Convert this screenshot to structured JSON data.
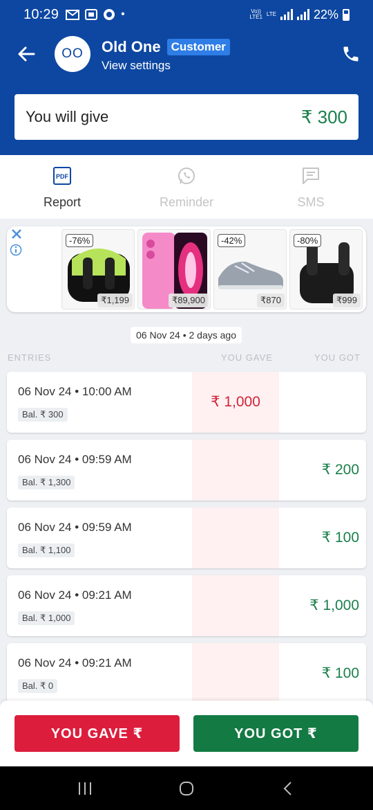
{
  "status_bar": {
    "time": "10:29",
    "network": "LTE",
    "battery": "22%",
    "dot": "•"
  },
  "header": {
    "avatar_initials": "OO",
    "name": "Old One",
    "badge": "Customer",
    "subtitle": "View settings"
  },
  "balance": {
    "label": "You will give",
    "amount": "₹ 300"
  },
  "actions": [
    {
      "label": "Report",
      "icon": "pdf-icon",
      "enabled": true
    },
    {
      "label": "Reminder",
      "icon": "whatsapp-icon",
      "enabled": false
    },
    {
      "label": "SMS",
      "icon": "sms-icon",
      "enabled": false
    }
  ],
  "ad": {
    "products": [
      {
        "discount": "-76%",
        "price": "₹1,199",
        "kind": "earbuds"
      },
      {
        "discount": "",
        "price": "₹89,900",
        "kind": "phone"
      },
      {
        "discount": "-42%",
        "price": "₹870",
        "kind": "shoes"
      },
      {
        "discount": "-80%",
        "price": "₹999",
        "kind": "earbuds-dark"
      }
    ]
  },
  "date_chip": "06 Nov 24 • 2 days ago",
  "columns": {
    "entries": "ENTRIES",
    "you_gave": "YOU GAVE",
    "you_got": "YOU GOT"
  },
  "entries": [
    {
      "datetime": "06 Nov 24 • 10:00 AM",
      "balance": "Bal. ₹ 300",
      "gave": "₹ 1,000",
      "got": ""
    },
    {
      "datetime": "06 Nov 24 • 09:59 AM",
      "balance": "Bal. ₹ 1,300",
      "gave": "",
      "got": "₹ 200"
    },
    {
      "datetime": "06 Nov 24 • 09:59 AM",
      "balance": "Bal. ₹ 1,100",
      "gave": "",
      "got": "₹ 100"
    },
    {
      "datetime": "06 Nov 24 • 09:21 AM",
      "balance": "Bal. ₹ 1,000",
      "gave": "",
      "got": "₹ 1,000"
    },
    {
      "datetime": "06 Nov 24 • 09:21 AM",
      "balance": "Bal. ₹ 0",
      "gave": "",
      "got": "₹ 100"
    }
  ],
  "buttons": {
    "gave": "YOU GAVE ₹",
    "got": "YOU GOT ₹"
  },
  "colors": {
    "primary": "#0d47a1",
    "gave": "#dd1d3c",
    "got": "#137a43"
  }
}
